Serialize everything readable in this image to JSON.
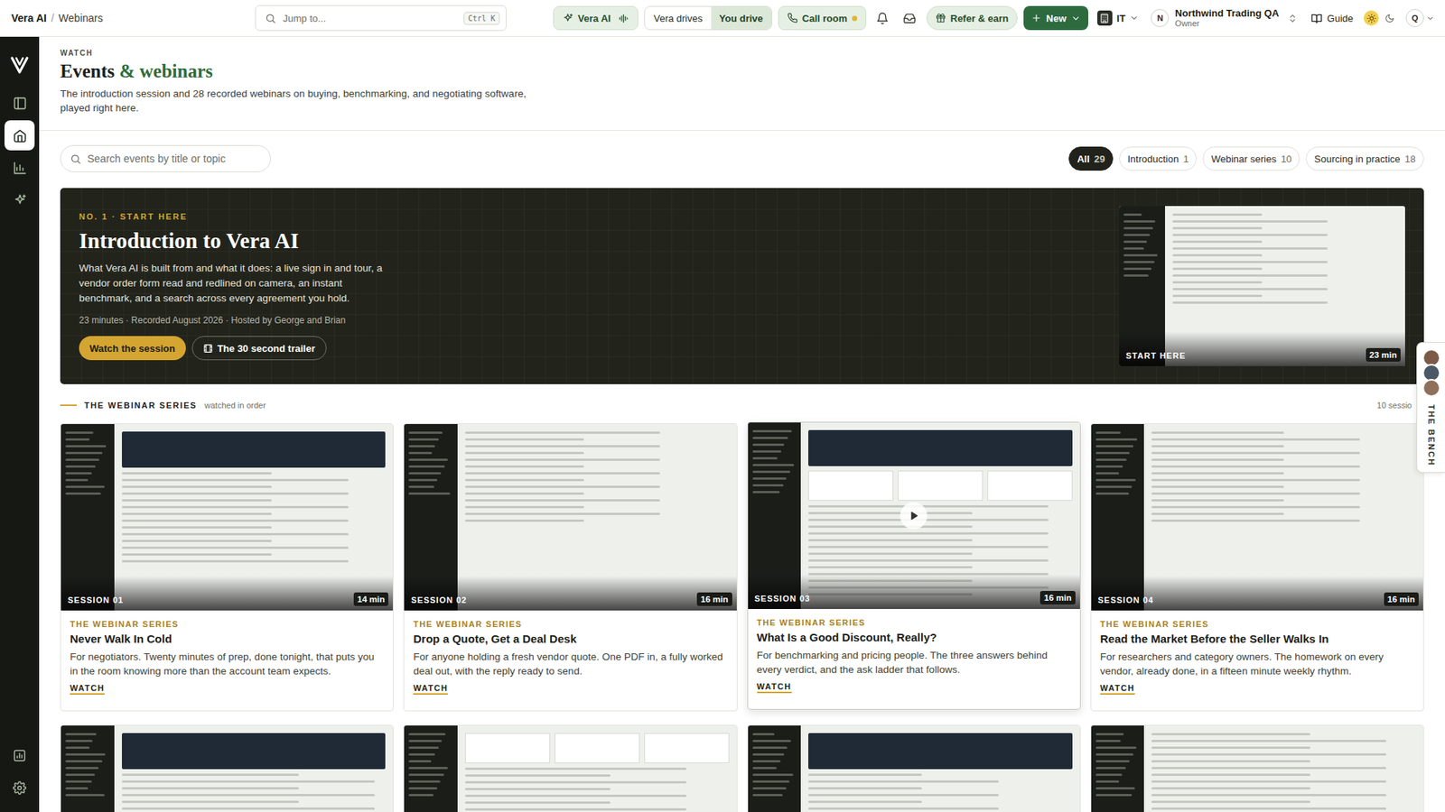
{
  "topbar": {
    "breadcrumb": {
      "app": "Vera AI",
      "separator": "/",
      "page": "Webinars"
    },
    "search": {
      "placeholder": "Jump to...",
      "shortcut": "Ctrl K"
    },
    "vera_button": "Vera AI",
    "mode_toggle": [
      {
        "label": "Vera drives",
        "selected": false
      },
      {
        "label": "You drive",
        "selected": true
      }
    ],
    "call_room": {
      "label": "Call room",
      "live": true,
      "color": "#e0b43a"
    },
    "refer": "Refer & earn",
    "new_button": "New",
    "workspace": "IT",
    "account": {
      "initial": "N",
      "name": "Northwind Trading QA",
      "role": "Owner"
    },
    "guide": "Guide",
    "theme": {
      "light_selected": true
    },
    "user_initial": "Q"
  },
  "sidebar": {
    "top": [
      {
        "selected": false
      },
      {
        "selected": true
      },
      {
        "selected": false
      },
      {
        "selected": false
      }
    ],
    "bottom": [
      {
        "selected": false
      },
      {
        "selected": false
      }
    ]
  },
  "header": {
    "eyebrow": "WATCH",
    "title_main": "Events",
    "title_accent": "& webinars",
    "description": "The introduction session and 28 recorded webinars on buying, benchmarking, and negotiating software, played right here."
  },
  "filters": {
    "search_placeholder": "Search events by title or topic",
    "pills": [
      {
        "label": "All",
        "count": "29",
        "selected": true
      },
      {
        "label": "Introduction",
        "count": "1",
        "selected": false
      },
      {
        "label": "Webinar series",
        "count": "10",
        "selected": false
      },
      {
        "label": "Sourcing in practice",
        "count": "18",
        "selected": false
      }
    ]
  },
  "hero": {
    "eyebrow": "NO. 1 · START HERE",
    "title": "Introduction to Vera AI",
    "description": "What Vera AI is built from and what it does: a live sign in and tour, a vendor order form read and redlined on camera, an instant benchmark, and a search across every agreement you hold.",
    "meta": "23 minutes · Recorded August 2026 · Hosted by George and Brian",
    "primary": "Watch the session",
    "secondary": "The 30 second trailer",
    "thumbnail": {
      "label": "START HERE",
      "duration": "23 min"
    }
  },
  "bench": {
    "label": "THE BENCH",
    "avatars": [
      {
        "color": "#7b5a47"
      },
      {
        "color": "#4c5866"
      },
      {
        "color": "#8e705c"
      }
    ]
  },
  "series": {
    "title": "THE WEBINAR SERIES",
    "subtitle": "watched in order",
    "count": "10 sessio",
    "cards": [
      {
        "session": "SESSION 01",
        "duration": "14 min",
        "eyebrow": "THE WEBINAR SERIES",
        "title": "Never Walk In Cold",
        "description": "For negotiators. Twenty minutes of prep, done tonight, that puts you in the room knowing more than the account team expects.",
        "link": "WATCH",
        "hovered": false
      },
      {
        "session": "SESSION 02",
        "duration": "16 min",
        "eyebrow": "THE WEBINAR SERIES",
        "title": "Drop a Quote, Get a Deal Desk",
        "description": "For anyone holding a fresh vendor quote. One PDF in, a fully worked deal out, with the reply ready to send.",
        "link": "WATCH",
        "hovered": false
      },
      {
        "session": "SESSION 03",
        "duration": "16 min",
        "eyebrow": "THE WEBINAR SERIES",
        "title": "What Is a Good Discount, Really?",
        "description": "For benchmarking and pricing people. The three answers behind every verdict, and the ask ladder that follows.",
        "link": "WATCH",
        "hovered": true
      },
      {
        "session": "SESSION 04",
        "duration": "16 min",
        "eyebrow": "THE WEBINAR SERIES",
        "title": "Read the Market Before the Seller Walks In",
        "description": "For researchers and category owners. The homework on every vendor, already done, in a fifteen minute weekly rhythm.",
        "link": "WATCH",
        "hovered": false
      }
    ],
    "next_row": [
      {
        "hovered": false
      },
      {
        "hovered": false
      },
      {
        "hovered": false
      },
      {
        "hovered": false
      }
    ]
  }
}
